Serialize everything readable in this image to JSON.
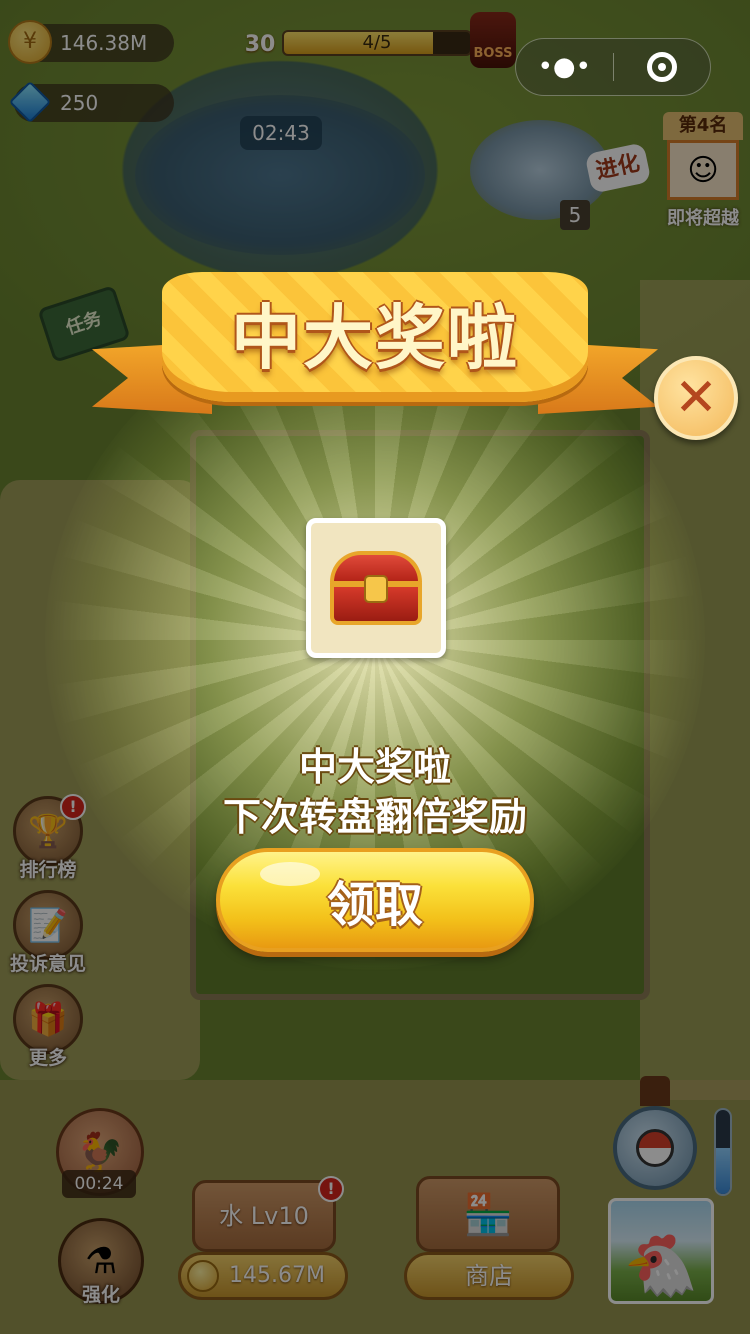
{
  "hud": {
    "coins": "146.38M",
    "gems": "250",
    "level": "30",
    "progress": "4/5",
    "progress_fraction": 0.8,
    "boss_label": "BOSS",
    "pond_timer": "02:43"
  },
  "capsule": {
    "more_icon": "more-dots-icon",
    "close_icon": "mini-program-close-icon"
  },
  "evolve": {
    "label": "进化",
    "count": "5"
  },
  "rank": {
    "top": "第4名",
    "bottom": "即将超越"
  },
  "quest_sign": "任务",
  "side_menu": [
    {
      "label": "排行榜",
      "icon": "trophy-icon",
      "badge": "!"
    },
    {
      "label": "投诉意见",
      "icon": "notepad-icon"
    },
    {
      "label": "更多",
      "icon": "gift-box-icon"
    }
  ],
  "bottom": {
    "boost_timer": "00:24",
    "strengthen_label": "强化",
    "water_label": "水 Lv10",
    "water_badge": "!",
    "water_cost": "145.67M",
    "shop_label": "商店",
    "gauge_fraction": 0.55
  },
  "popup": {
    "title": "中大奖啦",
    "line1": "中大奖啦",
    "line2": "下次转盘翻倍奖励",
    "claim_label": "领取",
    "close_symbol": "✕",
    "reward_icon": "treasure-chest-icon"
  },
  "colors": {
    "ribbon": "#ffd34a",
    "claim_button": "#fbe13a",
    "close_button": "#f3b85a",
    "badge_red": "#d8251c"
  }
}
